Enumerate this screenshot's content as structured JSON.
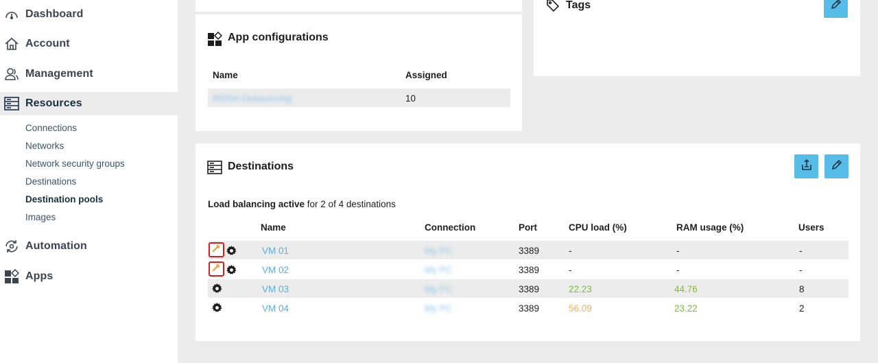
{
  "sidebar": {
    "items": [
      {
        "label": "Dashboard",
        "icon": "gauge-icon"
      },
      {
        "label": "Account",
        "icon": "home-icon"
      },
      {
        "label": "Management",
        "icon": "users-icon"
      },
      {
        "label": "Resources",
        "icon": "server-icon"
      },
      {
        "label": "Automation",
        "icon": "automation-icon"
      },
      {
        "label": "Apps",
        "icon": "apps-icon"
      }
    ],
    "sub_items": [
      "Connections",
      "Networks",
      "Network security groups",
      "Destinations",
      "Destination pools",
      "Images"
    ],
    "active_item": "Resources",
    "active_sub_item": "Destination pools"
  },
  "app_config": {
    "title": "App configurations",
    "headers": {
      "name": "Name",
      "assigned": "Assigned"
    },
    "rows": [
      {
        "name": "RDSH Outsourcing",
        "assigned": "10"
      }
    ]
  },
  "tags": {
    "title": "Tags"
  },
  "destinations": {
    "title": "Destinations",
    "lb_bold": "Load balancing active",
    "lb_rest": " for 2 of 4 destinations",
    "headers": {
      "name": "Name",
      "connection": "Connection",
      "port": "Port",
      "cpu": "CPU load (%)",
      "ram": "RAM usage (%)",
      "users": "Users"
    },
    "rows": [
      {
        "name": "VM 01",
        "connection": "My PC",
        "port": "3389",
        "cpu": "-",
        "ram": "-",
        "users": "-",
        "maintenance": true
      },
      {
        "name": "VM 02",
        "connection": "My PC",
        "port": "3389",
        "cpu": "-",
        "ram": "-",
        "users": "-",
        "maintenance": true
      },
      {
        "name": "VM 03",
        "connection": "My PC",
        "port": "3389",
        "cpu": "22.23",
        "ram": "44.76",
        "users": "8",
        "maintenance": false
      },
      {
        "name": "VM 04",
        "connection": "My PC",
        "port": "3389",
        "cpu": "56.09",
        "ram": "23.22",
        "users": "2",
        "maintenance": false
      }
    ]
  },
  "colors": {
    "accent": "#56bde8",
    "link": "#5aaee0",
    "good": "#7fbe2c",
    "warn": "#f0b15c",
    "alert": "#e11a1a"
  }
}
